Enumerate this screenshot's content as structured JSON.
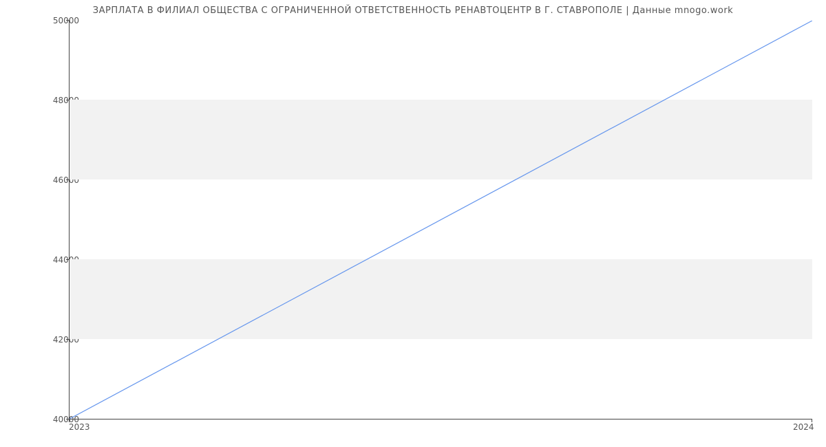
{
  "chart_data": {
    "type": "line",
    "title": "ЗАРПЛАТА В ФИЛИАЛ ОБЩЕСТВА С ОГРАНИЧЕННОЙ ОТВЕТСТВЕННОСТЬ РЕНАВТОЦЕНТР В Г. СТАВРОПОЛЕ | Данные mnogo.work",
    "x": [
      2023,
      2024
    ],
    "values": [
      40000,
      50000
    ],
    "xlabel": "",
    "ylabel": "",
    "x_ticks": [
      "2023",
      "2024"
    ],
    "y_ticks": [
      "40000",
      "42000",
      "44000",
      "46000",
      "48000",
      "50000"
    ],
    "xlim": [
      2023,
      2024
    ],
    "ylim": [
      40000,
      50000
    ],
    "line_color": "#6495ed",
    "band_color": "#f2f2f2",
    "grid": false
  }
}
